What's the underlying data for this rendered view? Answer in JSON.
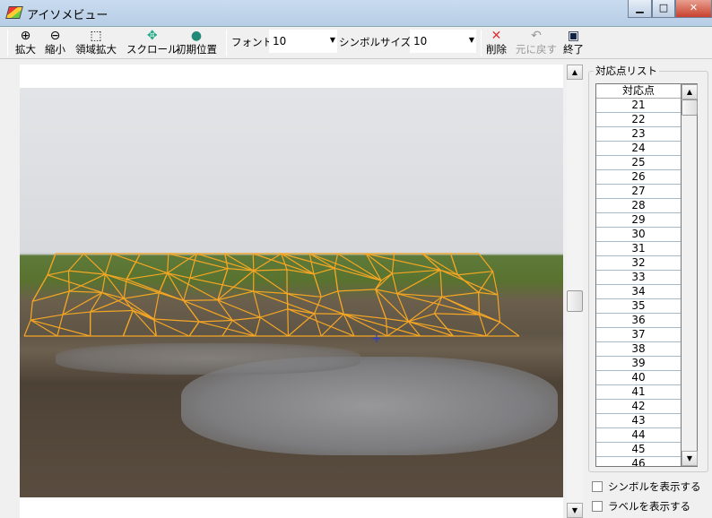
{
  "window": {
    "title": "アイソメビュー",
    "minimize": "▁",
    "maximize": "□",
    "close": "✕",
    "close_color": "#d9453b"
  },
  "toolbar": {
    "zoom_in": "拡大",
    "zoom_out": "縮小",
    "region_zoom": "領域拡大",
    "scroll": "スクロール",
    "initial_position": "初期位置",
    "font_label": "フォント:",
    "font_value": "10",
    "symbol_size_label": "シンボルサイズ:",
    "symbol_size_value": "10",
    "delete": "削除",
    "undo": "元に戻す",
    "exit": "終了"
  },
  "mesh_color": "#f5a623",
  "point_marker_color": "#2a3fc9",
  "panel": {
    "group_title": "対応点リスト",
    "list_header": "対応点",
    "items": [
      "21",
      "22",
      "23",
      "24",
      "25",
      "26",
      "27",
      "28",
      "29",
      "30",
      "31",
      "32",
      "33",
      "34",
      "35",
      "36",
      "37",
      "38",
      "39",
      "40",
      "41",
      "42",
      "43",
      "44",
      "45",
      "46"
    ],
    "show_symbols": "シンボルを表示する",
    "show_labels": "ラベルを表示する",
    "show_symbols_checked": false,
    "show_labels_checked": false
  }
}
